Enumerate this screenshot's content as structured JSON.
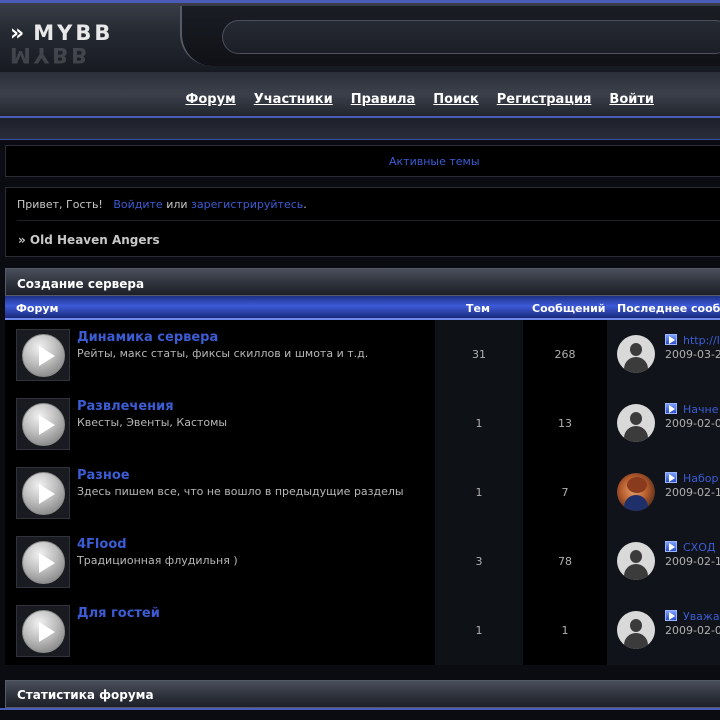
{
  "header": {
    "logo_text": "MYBB",
    "logo_arrow": "»"
  },
  "nav": {
    "items": [
      {
        "label": "Форум"
      },
      {
        "label": "Участники"
      },
      {
        "label": "Правила"
      },
      {
        "label": "Поиск"
      },
      {
        "label": "Регистрация"
      },
      {
        "label": "Войти"
      }
    ]
  },
  "active_topics": {
    "label": "Активные темы"
  },
  "welcome": {
    "greeting": "Привет, Гость!",
    "login_link": "Войдите",
    "or_text": "или",
    "register_link": "зарегистрируйтесь",
    "period": "."
  },
  "breadcrumb": {
    "text": "» Old Heaven Angers"
  },
  "category": {
    "title": "Создание сервера",
    "columns": {
      "forum": "Форум",
      "threads": "Тем",
      "posts": "Сообщений",
      "last_post": "Последнее сооб"
    },
    "forums": [
      {
        "name": "Динамика сервера",
        "desc": "Рейты, макс статы, фиксы скиллов и шмота и т.д.",
        "threads": "31",
        "posts": "268",
        "last_title": "http://l",
        "last_date": "2009-03-2",
        "avatar": "default"
      },
      {
        "name": "Развлечения",
        "desc": "Квесты, Эвенты, Кастомы",
        "threads": "1",
        "posts": "13",
        "last_title": "Начне",
        "last_date": "2009-02-0",
        "avatar": "default"
      },
      {
        "name": "Разное",
        "desc": "Здесь пишем все, что не вошло в предыдущие разделы",
        "threads": "1",
        "posts": "7",
        "last_title": "Набор",
        "last_date": "2009-02-1",
        "avatar": "photo"
      },
      {
        "name": "4Flood",
        "desc": "Традиционная флудильня )",
        "threads": "3",
        "posts": "78",
        "last_title": "СХОД",
        "last_date": "2009-02-1",
        "avatar": "default"
      },
      {
        "name": "Для гостей",
        "desc": "",
        "threads": "1",
        "posts": "1",
        "last_title": "Уважа",
        "last_date": "2009-02-0",
        "avatar": "default"
      }
    ]
  },
  "stats": {
    "title": "Статистика форума"
  },
  "colors": {
    "accent": "#3c5cd4",
    "header_blue": "#3d5bd9",
    "background": "#000000"
  }
}
